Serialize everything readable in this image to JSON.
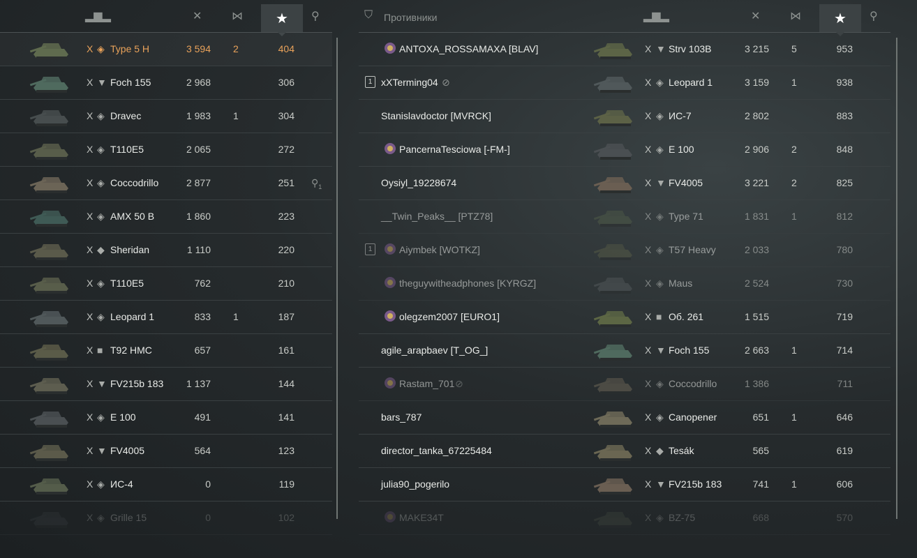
{
  "left": {
    "header": {
      "tank_icon": "tank-silhouette-icon",
      "frags_icon": "crossed-swords-icon",
      "assist_icon": "spot-damage-icon",
      "xp_icon": "star-icon",
      "medal_icon": "medal-icon"
    },
    "rows": [
      {
        "tier": "X",
        "cls": "◈",
        "tank": "Type 5 H",
        "damage": "3 594",
        "frags": "2",
        "xp": "404",
        "color": "#5f6b4e"
      },
      {
        "tier": "X",
        "cls": "▼",
        "tank": "Foch 155",
        "damage": "2 968",
        "frags": "",
        "xp": "306",
        "color": "#4f6a5e"
      },
      {
        "tier": "X",
        "cls": "◈",
        "tank": "Dravec",
        "damage": "1 983",
        "frags": "1",
        "xp": "304",
        "color": "#474d4e"
      },
      {
        "tier": "X",
        "cls": "◈",
        "tank": "T110E5",
        "damage": "2 065",
        "frags": "",
        "xp": "272",
        "color": "#585d4a"
      },
      {
        "tier": "X",
        "cls": "◈",
        "tank": "Coccodrillo",
        "damage": "2 877",
        "frags": "",
        "xp": "251",
        "color": "#6b6456",
        "medal": "1"
      },
      {
        "tier": "X",
        "cls": "◈",
        "tank": "AMX 50 B",
        "damage": "1 860",
        "frags": "",
        "xp": "223",
        "color": "#3f5a55"
      },
      {
        "tier": "X",
        "cls": "◆",
        "tank": "Sheridan",
        "damage": "1 110",
        "frags": "",
        "xp": "220",
        "color": "#5a5a4a"
      },
      {
        "tier": "X",
        "cls": "◈",
        "tank": "T110E5",
        "damage": "762",
        "frags": "",
        "xp": "210",
        "color": "#585d4a"
      },
      {
        "tier": "X",
        "cls": "◈",
        "tank": "Leopard 1",
        "damage": "833",
        "frags": "1",
        "xp": "187",
        "color": "#50585a"
      },
      {
        "tier": "X",
        "cls": "■",
        "tank": "T92 HMC",
        "damage": "657",
        "frags": "",
        "xp": "161",
        "color": "#5a5b48"
      },
      {
        "tier": "X",
        "cls": "▼",
        "tank": "FV215b 183",
        "damage": "1 137",
        "frags": "",
        "xp": "144",
        "color": "#5d5d4f"
      },
      {
        "tier": "X",
        "cls": "◈",
        "tank": "E 100",
        "damage": "491",
        "frags": "",
        "xp": "141",
        "color": "#4a4f52"
      },
      {
        "tier": "X",
        "cls": "▼",
        "tank": "FV4005",
        "damage": "564",
        "frags": "",
        "xp": "123",
        "color": "#5b5a4a"
      },
      {
        "tier": "X",
        "cls": "◈",
        "tank": "ИС-4",
        "damage": "0",
        "frags": "",
        "xp": "119",
        "color": "#545c4a"
      },
      {
        "tier": "X",
        "cls": "◈",
        "tank": "Grille 15",
        "damage": "0",
        "frags": "",
        "xp": "102",
        "color": "#3e4448"
      }
    ]
  },
  "right": {
    "header": {
      "title": "Противники",
      "shield_icon": "shield-icon",
      "tank_icon": "tank-silhouette-icon",
      "frags_icon": "crossed-swords-icon",
      "assist_icon": "spot-damage-icon",
      "xp_icon": "star-icon",
      "medal_icon": "medal-icon"
    },
    "rows": [
      {
        "player": "ANTOXA_ROSSAMAXA [BLAV]",
        "clan": true,
        "rank": "",
        "hidden": false,
        "tier": "X",
        "cls": "▼",
        "tank": "Strv 103B",
        "damage": "3 215",
        "frags": "5",
        "xp": "953",
        "color": "#5c6446"
      },
      {
        "player": "xXTerming04",
        "clan": false,
        "rank": "1",
        "hidden": true,
        "tier": "X",
        "cls": "◈",
        "tank": "Leopard 1",
        "damage": "3 159",
        "frags": "1",
        "xp": "938",
        "color": "#50585a"
      },
      {
        "player": "Stanislavdoctor [MVRCK]",
        "clan": false,
        "rank": "",
        "hidden": false,
        "tier": "X",
        "cls": "◈",
        "tank": "ИС-7",
        "damage": "2 802",
        "frags": "",
        "xp": "883",
        "color": "#5c6146"
      },
      {
        "player": "PancernaTesciowa [-FM-]",
        "clan": true,
        "rank": "",
        "hidden": false,
        "tier": "X",
        "cls": "◈",
        "tank": "E 100",
        "damage": "2 906",
        "frags": "2",
        "xp": "848",
        "color": "#4a4f52"
      },
      {
        "player": "Oysiyl_19228674",
        "clan": false,
        "rank": "",
        "hidden": false,
        "tier": "X",
        "cls": "▼",
        "tank": "FV4005",
        "damage": "3 221",
        "frags": "2",
        "xp": "825",
        "color": "#6a5e52"
      },
      {
        "player": "__Twin_Peaks__ [PTZ78]",
        "clan": false,
        "rank": "",
        "hidden": false,
        "dim": true,
        "tier": "X",
        "cls": "◈",
        "tank": "Type 71",
        "damage": "1 831",
        "frags": "1",
        "xp": "812",
        "color": "#4f5a48"
      },
      {
        "player": "Aiymbek [WOTKZ]",
        "clan": true,
        "rank": "1",
        "hidden": false,
        "dim": true,
        "tier": "X",
        "cls": "◈",
        "tank": "T57 Heavy",
        "damage": "2 033",
        "frags": "",
        "xp": "780",
        "color": "#555a46"
      },
      {
        "player": "theguywitheadphones [KYRGZ]",
        "clan": true,
        "rank": "",
        "hidden": false,
        "dim": true,
        "tier": "X",
        "cls": "◈",
        "tank": "Maus",
        "damage": "2 524",
        "frags": "",
        "xp": "730",
        "color": "#52585a"
      },
      {
        "player": "olegzem2007 [EURO1]",
        "clan": true,
        "rank": "",
        "hidden": false,
        "tier": "X",
        "cls": "■",
        "tank": "Об. 261",
        "damage": "1 515",
        "frags": "",
        "xp": "719",
        "color": "#5c6644"
      },
      {
        "player": "agile_arapbaev [T_OG_]",
        "clan": false,
        "rank": "",
        "hidden": false,
        "tier": "X",
        "cls": "▼",
        "tank": "Foch 155",
        "damage": "2 663",
        "frags": "1",
        "xp": "714",
        "color": "#4f6a5e"
      },
      {
        "player": "Rastam_701",
        "clan": true,
        "rank": "",
        "hidden": true,
        "dim": true,
        "tier": "X",
        "cls": "◈",
        "tank": "Coccodrillo",
        "damage": "1 386",
        "frags": "",
        "xp": "711",
        "color": "#6b6456"
      },
      {
        "player": "bars_787",
        "clan": false,
        "rank": "",
        "hidden": false,
        "tier": "X",
        "cls": "◈",
        "tank": "Canopener",
        "damage": "651",
        "frags": "1",
        "xp": "646",
        "color": "#6e6a58"
      },
      {
        "player": "director_tanka_67225484",
        "clan": false,
        "rank": "",
        "hidden": false,
        "tier": "X",
        "cls": "◆",
        "tank": "Tesák",
        "damage": "565",
        "frags": "",
        "xp": "619",
        "color": "#6a6652"
      },
      {
        "player": "julia90_pogerilo",
        "clan": false,
        "rank": "",
        "hidden": false,
        "tier": "X",
        "cls": "▼",
        "tank": "FV215b 183",
        "damage": "741",
        "frags": "1",
        "xp": "606",
        "color": "#6a5e52"
      },
      {
        "player": "MAKE34T",
        "clan": true,
        "rank": "",
        "hidden": false,
        "tier": "X",
        "cls": "◈",
        "tank": "BZ-75",
        "damage": "668",
        "frags": "",
        "xp": "570",
        "color": "#4f5a4a"
      }
    ]
  }
}
